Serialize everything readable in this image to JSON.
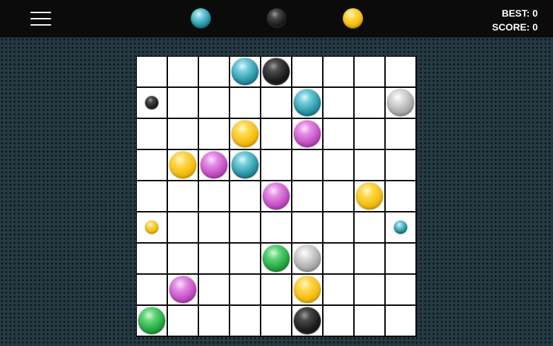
{
  "app": {
    "menu_icon": "hamburger-menu-icon"
  },
  "next_balls": [
    "teal",
    "black",
    "yellow"
  ],
  "scores": {
    "best_label": "BEST:",
    "best_value": "0",
    "score_label": "SCORE:",
    "score_value": "0"
  },
  "board": {
    "rows": 9,
    "cols": 9,
    "balls": [
      {
        "row": 0,
        "col": 3,
        "color": "teal",
        "size": "big"
      },
      {
        "row": 0,
        "col": 4,
        "color": "black",
        "size": "big"
      },
      {
        "row": 1,
        "col": 0,
        "color": "black",
        "size": "small"
      },
      {
        "row": 1,
        "col": 5,
        "color": "teal",
        "size": "big"
      },
      {
        "row": 1,
        "col": 8,
        "color": "silver",
        "size": "big"
      },
      {
        "row": 2,
        "col": 3,
        "color": "yellow",
        "size": "big"
      },
      {
        "row": 2,
        "col": 5,
        "color": "purple",
        "size": "big"
      },
      {
        "row": 3,
        "col": 1,
        "color": "yellow",
        "size": "big"
      },
      {
        "row": 3,
        "col": 2,
        "color": "purple",
        "size": "big"
      },
      {
        "row": 3,
        "col": 3,
        "color": "teal",
        "size": "big"
      },
      {
        "row": 4,
        "col": 4,
        "color": "purple",
        "size": "big"
      },
      {
        "row": 4,
        "col": 7,
        "color": "yellow",
        "size": "big"
      },
      {
        "row": 5,
        "col": 0,
        "color": "yellow",
        "size": "small"
      },
      {
        "row": 5,
        "col": 8,
        "color": "teal",
        "size": "small"
      },
      {
        "row": 6,
        "col": 4,
        "color": "green",
        "size": "big"
      },
      {
        "row": 6,
        "col": 5,
        "color": "silver",
        "size": "big"
      },
      {
        "row": 7,
        "col": 1,
        "color": "purple",
        "size": "big"
      },
      {
        "row": 7,
        "col": 5,
        "color": "yellow",
        "size": "big"
      },
      {
        "row": 8,
        "col": 0,
        "color": "green",
        "size": "big"
      },
      {
        "row": 8,
        "col": 5,
        "color": "black",
        "size": "big"
      }
    ]
  },
  "colors": {
    "background": "#253a42",
    "topbar": "#0b0b0b",
    "grid_line": "#000000",
    "cell": "#ffffff"
  }
}
